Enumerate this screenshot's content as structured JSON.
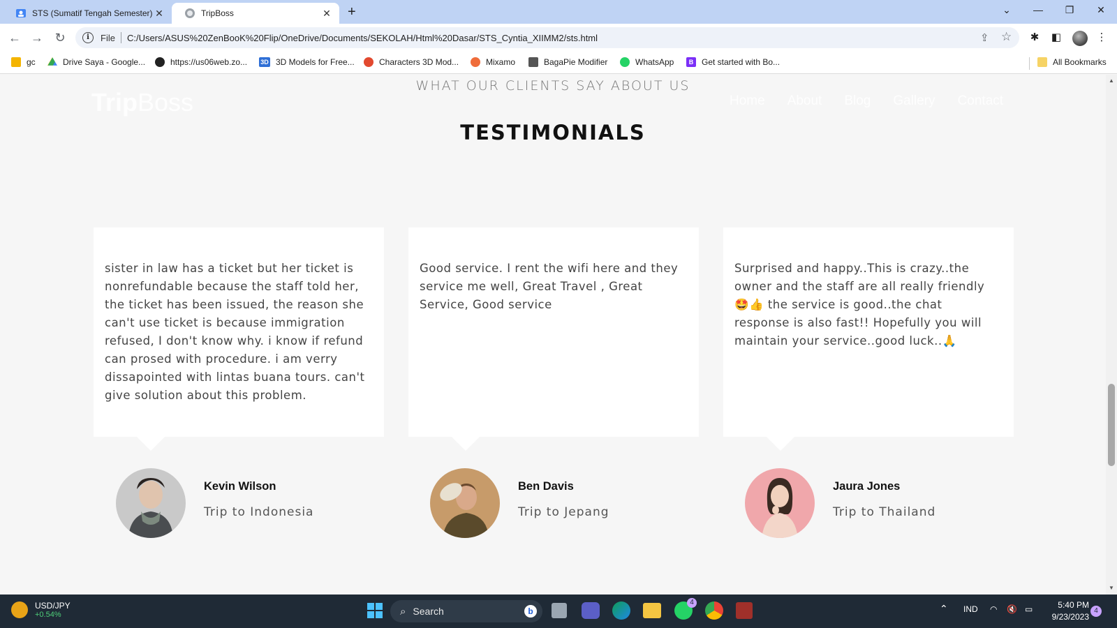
{
  "browser": {
    "tabs": [
      {
        "title": "STS (Sumatif Tengah Semester) C",
        "active": false
      },
      {
        "title": "TripBoss",
        "active": true
      }
    ],
    "address": {
      "scheme": "File",
      "url": "C:/Users/ASUS%20ZenBooK%20Flip/OneDrive/Documents/SEKOLAH/Html%20Dasar/STS_Cyntia_XIIMM2/sts.html"
    },
    "bookmarks": [
      {
        "label": "gc",
        "icon": "classroom-icon",
        "color": "#f4b400"
      },
      {
        "label": "Drive Saya - Google...",
        "icon": "drive-icon",
        "color": "#34a853"
      },
      {
        "label": "https://us06web.zo...",
        "icon": "globe-icon",
        "color": "#222222"
      },
      {
        "label": "3D Models for Free...",
        "icon": "3d-icon",
        "color": "#2f6fd6"
      },
      {
        "label": "Characters 3D Mod...",
        "icon": "pinwheel-icon",
        "color": "#e2492f"
      },
      {
        "label": "Mixamo",
        "icon": "mixamo-icon",
        "color": "#ef6c3a"
      },
      {
        "label": "BagaPie Modifier",
        "icon": "bagapie-icon",
        "color": "#555555"
      },
      {
        "label": "WhatsApp",
        "icon": "whatsapp-icon",
        "color": "#25d366"
      },
      {
        "label": "Get started with Bo...",
        "icon": "bootstrap-icon",
        "color": "#7b2ff7"
      }
    ],
    "all_bookmarks": "All Bookmarks"
  },
  "page": {
    "logo": {
      "bold": "Trip",
      "light": "Boss"
    },
    "nav": [
      "Home",
      "About",
      "Blog",
      "Gallery",
      "Contact"
    ],
    "eyebrow": "WHAT OUR CLIENTS SAY ABOUT US",
    "heading": "TESTIMONIALS",
    "testimonials": [
      {
        "text": "sister in law has a ticket but her ticket is nonrefundable because the staff told her, the ticket has been issued, the reason she can't use ticket is because immigration refused, I don't know why. i know if refund can prosed with procedure. i am verry dissapointed with lintas buana tours. can't give solution about this problem.",
        "name": "Kevin Wilson",
        "trip": "Trip to Indonesia"
      },
      {
        "text": "Good service. I rent the wifi here and they service me well, Great Travel , Great Service, Good service",
        "name": "Ben Davis",
        "trip": "Trip to Jepang"
      },
      {
        "text": "Surprised and happy..This is crazy..the owner and the staff are all really friendly 🤩👍 the service is good..the chat response is also fast!! Hopefully you will maintain your service..good luck..🙏",
        "name": "Jaura Jones",
        "trip": "Trip to Thailand"
      }
    ]
  },
  "taskbar": {
    "ticker": {
      "symbol": "USD/JPY",
      "change": "+0.54%"
    },
    "search": "Search",
    "whatsapp_badge": "4",
    "language": "IND",
    "time": "5:40 PM",
    "date": "9/23/2023",
    "notifications": "4"
  }
}
